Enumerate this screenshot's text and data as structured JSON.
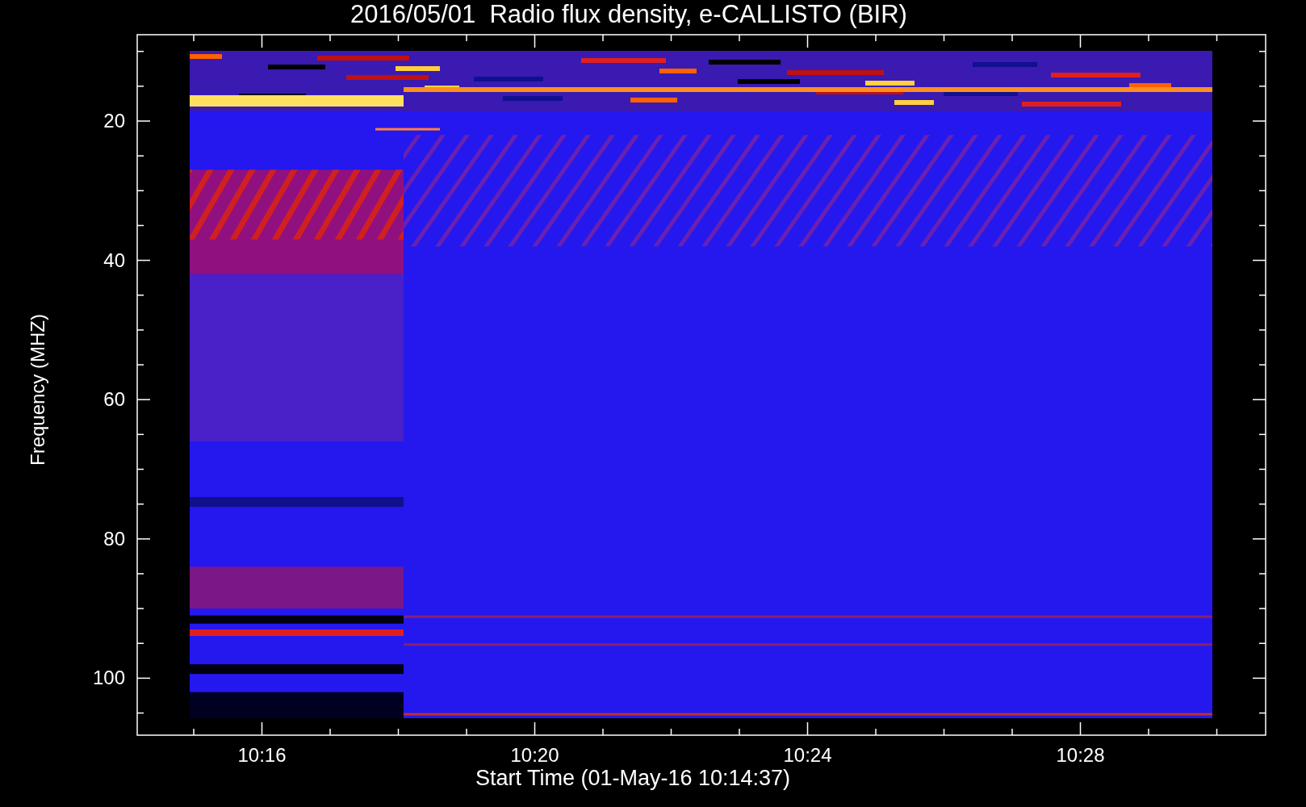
{
  "title": "2016/05/01  Radio flux density, e-CALLISTO (BIR)",
  "y_axis": {
    "label": "Frequency (MHZ)",
    "ticks": [
      "20",
      "40",
      "60",
      "80",
      "100"
    ]
  },
  "x_axis": {
    "label": "Start Time (01-May-16 10:14:37)",
    "ticks": [
      "10:16",
      "10:20",
      "10:24",
      "10:28"
    ]
  }
}
